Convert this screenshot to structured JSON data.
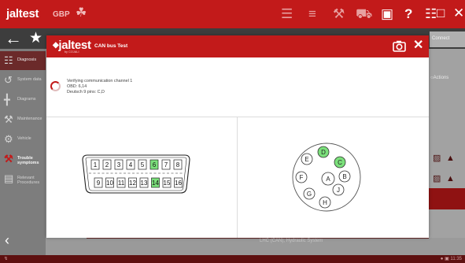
{
  "app": {
    "logo": "jaltest",
    "logo_sub": "by COJALI",
    "region": "GBP",
    "connect_tab": "Connect",
    "actions_label": "Actions",
    "lhc_text": "LHC (CAN), Hydraulic System",
    "sidebar": [
      {
        "label": "Diagnosis",
        "icon": "diagnosis-icon"
      },
      {
        "label": "System data",
        "icon": "system-data-icon"
      },
      {
        "label": "Diagrams",
        "icon": "diagrams-icon"
      },
      {
        "label": "Maintenance",
        "icon": "maintenance-icon"
      },
      {
        "label": "Vehicle",
        "icon": "vehicle-icon"
      },
      {
        "label": "Trouble symptoms",
        "icon": "trouble-icon"
      },
      {
        "label": "Relevant Procedures",
        "icon": "procedures-icon"
      }
    ],
    "status_time": "11:35"
  },
  "modal": {
    "title": "CAN bus Test",
    "status_lines": [
      "Verifying communication channel 1",
      "OBD: 6,14",
      "Deutsch 9 pins: C,D"
    ],
    "obd_connector": {
      "top_pins": [
        "1",
        "2",
        "3",
        "4",
        "5",
        "6",
        "7",
        "8"
      ],
      "bottom_pins": [
        "9",
        "10",
        "11",
        "12",
        "13",
        "14",
        "15",
        "16"
      ],
      "highlighted": [
        "6",
        "14"
      ]
    },
    "deutsch_connector": {
      "pins": [
        "A",
        "B",
        "C",
        "D",
        "E",
        "F",
        "G",
        "H",
        "J"
      ],
      "highlighted": [
        "C",
        "D"
      ]
    }
  },
  "colors": {
    "brand_red": "#c21a1a",
    "pin_highlight": "#7be07b"
  }
}
